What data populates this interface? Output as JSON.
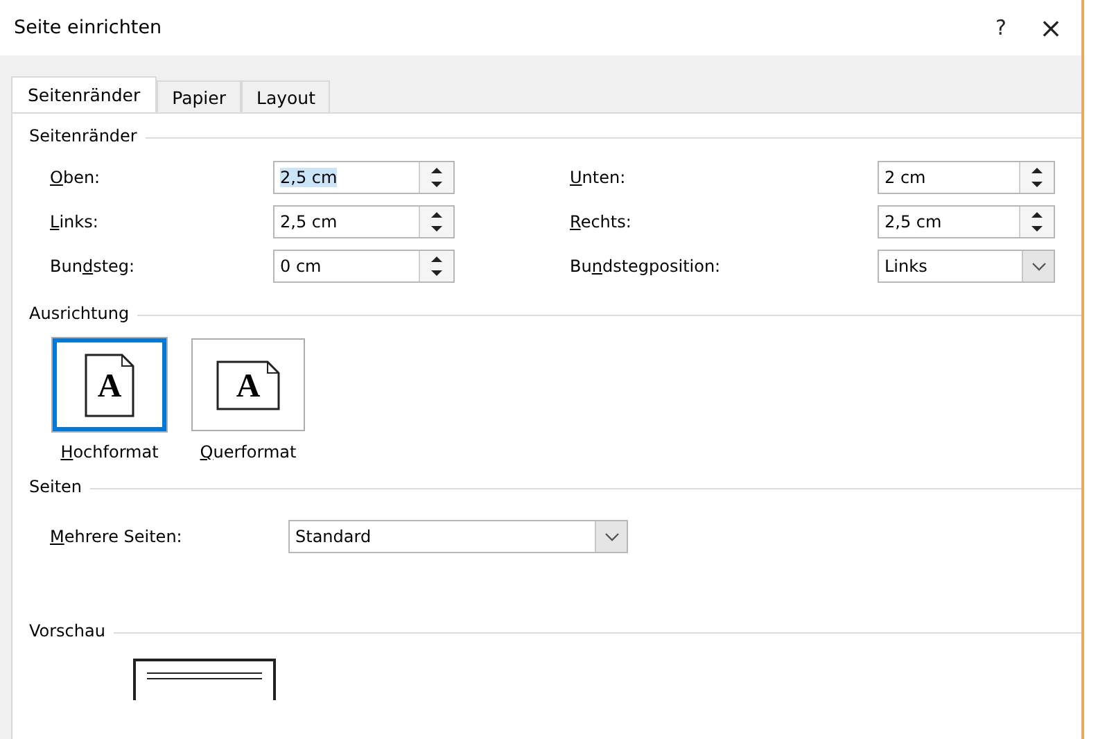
{
  "window": {
    "title": "Seite einrichten",
    "help": "?",
    "close": "×"
  },
  "tabs": [
    {
      "label": "Seitenränder",
      "selected": true
    },
    {
      "label": "Papier",
      "selected": false
    },
    {
      "label": "Layout",
      "selected": false
    }
  ],
  "margins": {
    "heading": "Seitenränder",
    "left_fields": [
      {
        "label": {
          "key": "O",
          "after": "ben:"
        },
        "kind": "spin",
        "value": "2,5 cm",
        "text_selected": true
      },
      {
        "label": {
          "key": "L",
          "after": "inks:"
        },
        "kind": "spin",
        "value": "2,5 cm",
        "text_selected": false
      },
      {
        "label": {
          "before": "Bun",
          "key": "d",
          "after": "steg:"
        },
        "kind": "spin",
        "value": "0 cm",
        "text_selected": false
      }
    ],
    "right_fields": [
      {
        "label": {
          "key": "U",
          "after": "nten:"
        },
        "kind": "spin",
        "value": "2 cm",
        "text_selected": false
      },
      {
        "label": {
          "key": "R",
          "after": "echts:"
        },
        "kind": "spin",
        "value": "2,5 cm",
        "text_selected": false
      },
      {
        "label": {
          "before": "Bu",
          "key": "n",
          "after": "dstegposition:"
        },
        "kind": "combo",
        "value": "Links",
        "text_selected": false
      }
    ]
  },
  "orientation": {
    "heading": "Ausrichtung",
    "options": [
      {
        "label": {
          "key": "H",
          "after": "ochformat"
        },
        "glyph": "A",
        "kind": "portrait",
        "selected": true
      },
      {
        "label": {
          "key": "Q",
          "after": "uerformat"
        },
        "glyph": "A",
        "kind": "landscape",
        "selected": false
      }
    ]
  },
  "pages": {
    "heading": "Seiten",
    "field": {
      "label": {
        "key": "M",
        "after": "ehrere Seiten:"
      },
      "kind": "combo",
      "value": "Standard",
      "text_selected": false
    }
  },
  "preview": {
    "heading": "Vorschau"
  }
}
